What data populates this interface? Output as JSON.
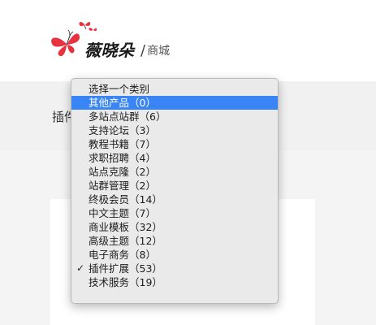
{
  "header": {
    "logo_text": "薇晓朵",
    "logo_sub": "商城",
    "logo_divider": "/"
  },
  "filter": {
    "label": "插件"
  },
  "dropdown": {
    "options": [
      {
        "label": "选择一个类别",
        "state": "placeholder"
      },
      {
        "label": "其他产品（0）",
        "state": "highlighted"
      },
      {
        "label": "多站点站群（6）",
        "state": "normal"
      },
      {
        "label": "支持论坛（3）",
        "state": "normal"
      },
      {
        "label": "教程书籍（7）",
        "state": "normal"
      },
      {
        "label": "求职招聘（4）",
        "state": "normal"
      },
      {
        "label": "站点克隆（2）",
        "state": "normal"
      },
      {
        "label": "站群管理（2）",
        "state": "normal"
      },
      {
        "label": "终极会员（14）",
        "state": "normal"
      },
      {
        "label": "中文主题（7）",
        "state": "normal"
      },
      {
        "label": "商业模板（32）",
        "state": "normal"
      },
      {
        "label": "高级主题（12）",
        "state": "normal"
      },
      {
        "label": "电子商务（8）",
        "state": "normal"
      },
      {
        "label": "插件扩展（53）",
        "state": "selected"
      },
      {
        "label": "技术服务（19）",
        "state": "normal"
      }
    ],
    "check_glyph": "✓",
    "highlight_color": "#3a85f6"
  },
  "colors": {
    "brand_red": "#e8333f",
    "band_gray": "#f1f1f1"
  }
}
